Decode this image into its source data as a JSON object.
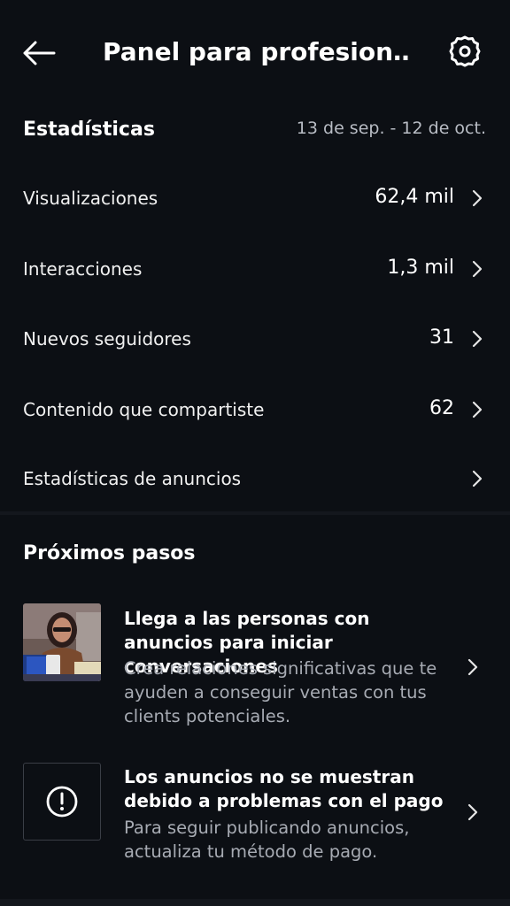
{
  "header": {
    "title": "Panel para profesion…",
    "back_icon": "arrow-left-icon",
    "settings_icon": "gear-icon"
  },
  "stats": {
    "title": "Estadísticas",
    "date_range": "13 de sep. - 12 de oct.",
    "rows": [
      {
        "label": "Visualizaciones",
        "value": "62,4 mil"
      },
      {
        "label": "Interacciones",
        "value": "1,3 mil"
      },
      {
        "label": "Nuevos seguidores",
        "value": "31"
      },
      {
        "label": "Contenido que compartiste",
        "value": "62"
      },
      {
        "label": "Estadísticas de anuncios",
        "value": ""
      }
    ]
  },
  "next_steps": {
    "title": "Próximos pasos",
    "cards": [
      {
        "title": "Llega a las personas con anuncios para iniciar conversaciones",
        "description": "Crea relaciones significativas que te ayuden a conseguir ventas con tus clients potenciales.",
        "icon": "person-photo-thumbnail"
      },
      {
        "title": "Los anuncios no se muestran debido a problemas con el pago",
        "description": "Para seguir publicando anuncios, actualiza tu método de pago.",
        "icon": "alert-circle-icon"
      }
    ]
  },
  "colors": {
    "background": "#0c0f14",
    "text_primary": "#ffffff",
    "text_secondary": "#a7abb3"
  }
}
